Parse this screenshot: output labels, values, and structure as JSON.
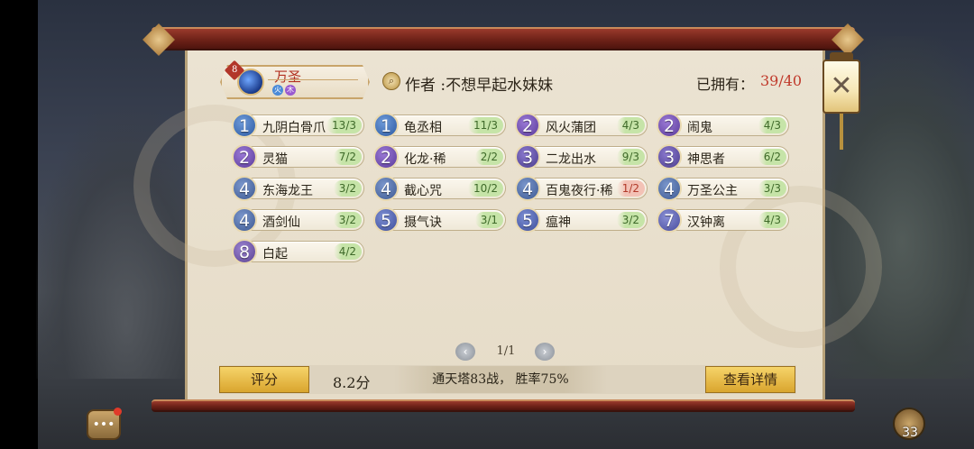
{
  "owner": {
    "tag": "8",
    "name": "万圣",
    "elements": [
      "火",
      "木"
    ]
  },
  "author": {
    "label": "作者 :不想早起水妹妹"
  },
  "owned": {
    "label": "已拥有：",
    "value": "39/40"
  },
  "cards": [
    {
      "level": "1",
      "name": "九阴白骨爪",
      "count": "13/3",
      "warn": false
    },
    {
      "level": "1",
      "name": "龟丞相",
      "count": "11/3",
      "warn": false
    },
    {
      "level": "2",
      "name": "风火蒲团",
      "count": "4/3",
      "warn": false
    },
    {
      "level": "2",
      "name": "闹鬼",
      "count": "4/3",
      "warn": false
    },
    {
      "level": "2",
      "name": "灵猫",
      "count": "7/2",
      "warn": false
    },
    {
      "level": "2",
      "name": "化龙·稀",
      "count": "2/2",
      "warn": false
    },
    {
      "level": "3",
      "name": "二龙出水",
      "count": "9/3",
      "warn": false
    },
    {
      "level": "3",
      "name": "神思者",
      "count": "6/2",
      "warn": false
    },
    {
      "level": "4",
      "name": "东海龙王",
      "count": "3/2",
      "warn": false
    },
    {
      "level": "4",
      "name": "截心咒",
      "count": "10/2",
      "warn": false
    },
    {
      "level": "4",
      "name": "百鬼夜行·稀",
      "count": "1/2",
      "warn": true
    },
    {
      "level": "4",
      "name": "万圣公主",
      "count": "3/3",
      "warn": false
    },
    {
      "level": "4",
      "name": "酒剑仙",
      "count": "3/2",
      "warn": false
    },
    {
      "level": "5",
      "name": "摄气诀",
      "count": "3/1",
      "warn": false
    },
    {
      "level": "5",
      "name": "瘟神",
      "count": "3/2",
      "warn": false
    },
    {
      "level": "7",
      "name": "汉钟离",
      "count": "4/3",
      "warn": false
    },
    {
      "level": "8",
      "name": "白起",
      "count": "4/2",
      "warn": false
    }
  ],
  "pager": {
    "text": "1/1",
    "prev": "‹",
    "next": "›"
  },
  "footer": {
    "score_label": "评分",
    "score_value": "8.2分",
    "stats": "通天塔83战， 胜率75%",
    "detail_label": "查看详情"
  },
  "close": {
    "glyph": "✕"
  },
  "chat": {
    "glyph": "•••"
  },
  "bag": {
    "count": "33"
  },
  "colors": {
    "accent_red": "#c0392b",
    "gold_button": "#e8bc48",
    "count_green": "#c6e4a8",
    "count_warn": "#f3c2b6"
  }
}
